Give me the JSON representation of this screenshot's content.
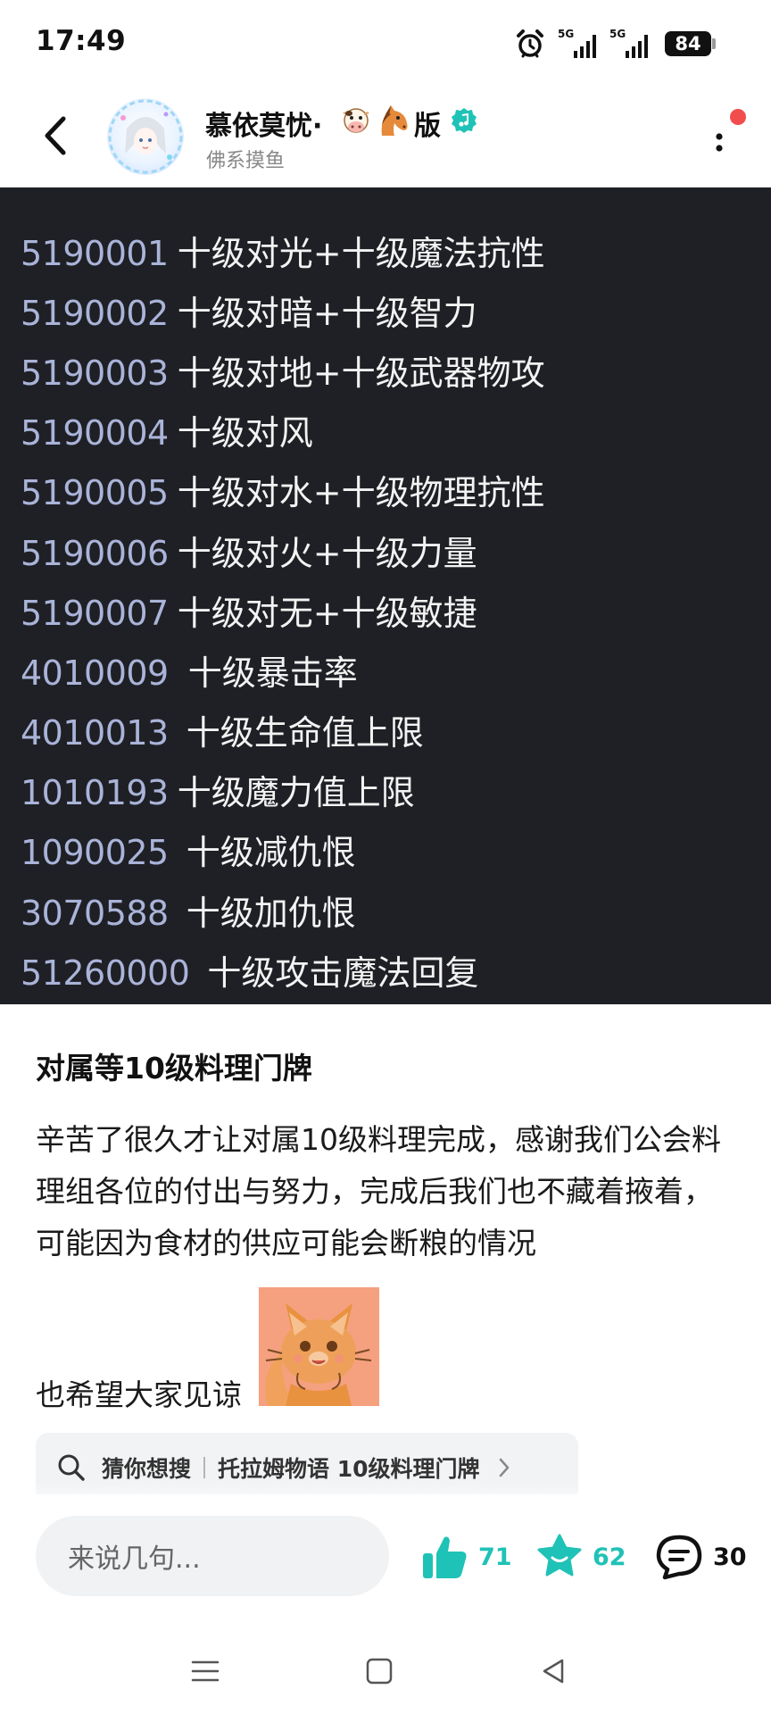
{
  "status_bar": {
    "time": "17:49",
    "network_1": "5G",
    "network_2": "5G",
    "battery": "84"
  },
  "header": {
    "author_name": "慕依莫忧·",
    "author_name_suffix": "版",
    "emoji_icons": [
      "cow-face-icon",
      "horse-face-icon"
    ],
    "author_subtitle": "佛系摸鱼",
    "verified_color": "#1fc2b6"
  },
  "code_image": {
    "rows": [
      {
        "id": "5190001",
        "desc": "十级对光+十级魔法抗性"
      },
      {
        "id": "5190002",
        "desc": "十级对暗+十级智力"
      },
      {
        "id": "5190003",
        "desc": "十级对地+十级武器物攻"
      },
      {
        "id": "5190004",
        "desc": "十级对风"
      },
      {
        "id": "5190005",
        "desc": "十级对水+十级物理抗性"
      },
      {
        "id": "5190006",
        "desc": "十级对火+十级力量"
      },
      {
        "id": "5190007",
        "desc": "十级对无+十级敏捷"
      },
      {
        "id": "4010009",
        "desc": "十级暴击率"
      },
      {
        "id": "4010013",
        "desc": "十级生命值上限"
      },
      {
        "id": "1010193",
        "desc": "十级魔力值上限"
      },
      {
        "id": "1090025",
        "desc": "十级减仇恨"
      },
      {
        "id": "3070588",
        "desc": "十级加仇恨"
      },
      {
        "id": "51260000",
        "desc": "十级攻击魔法回复"
      }
    ]
  },
  "post": {
    "title": "对属等10级料理门牌",
    "paragraph": "辛苦了很久才让对属10级料理完成，感谢我们公会料理组各位的付出与努力，完成后我们也不藏着掖着，可能因为食材的供应可能会断粮的情况",
    "line2": "也希望大家见谅"
  },
  "search_suggestion": {
    "label": "猜你想搜",
    "term": "托拉姆物语 10级料理门牌"
  },
  "actions": {
    "comment_placeholder": "来说几句...",
    "likes": "71",
    "favorites": "62",
    "comments": "30",
    "accent_color": "#1fc2b6"
  }
}
